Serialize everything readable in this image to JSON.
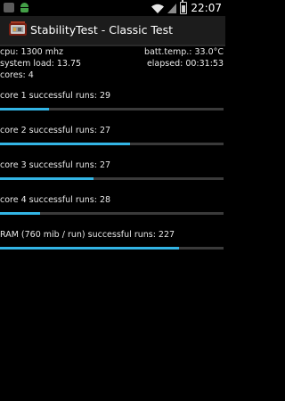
{
  "status_bar": {
    "time": "22:07",
    "icons": [
      "image-icon",
      "android-icon",
      "wifi-icon",
      "signal-icon",
      "battery-icon"
    ],
    "colors": {
      "android": "#43a047"
    }
  },
  "action_bar": {
    "title": "StabilityTest - Classic Test",
    "icon": "app-icon"
  },
  "info": {
    "cpu": "cpu: 1300 mhz",
    "batt_temp": "batt.temp.: 33.0°C",
    "system_load": "system load: 13.75",
    "elapsed": "elapsed: 00:31:53",
    "cores": "cores: 4"
  },
  "runs": [
    {
      "label": "core 1 successful runs: 29",
      "progress": 0.22
    },
    {
      "label": "core 2 successful runs: 27",
      "progress": 0.58
    },
    {
      "label": "core 3 successful runs: 27",
      "progress": 0.42
    },
    {
      "label": "core 4 successful runs: 28",
      "progress": 0.18
    },
    {
      "label": "RAM (760 mib / run) successful runs: 227",
      "progress": 0.8
    }
  ],
  "colors": {
    "accent": "#33b5e5",
    "track": "#3a3a3a",
    "background": "#000000",
    "action_bar": "#1c1c1c"
  }
}
